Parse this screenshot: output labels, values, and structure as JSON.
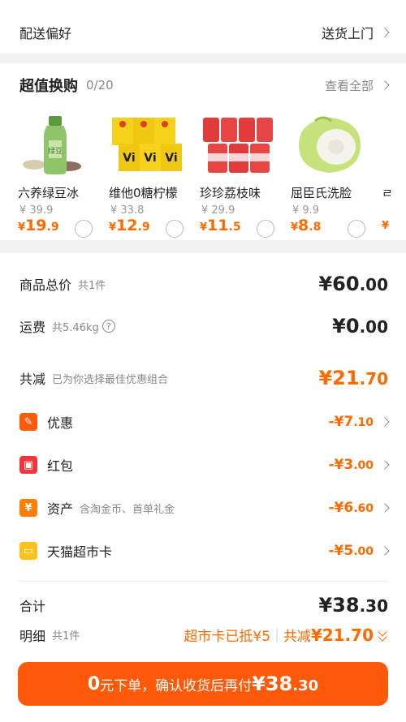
{
  "delivery": {
    "label": "配送偏好",
    "value": "送货上门"
  },
  "deals": {
    "title": "超值换购",
    "count": "0/20",
    "view_all": "查看全部",
    "items": [
      {
        "name": "六养绿豆冰",
        "old_price": "¥ 39.9",
        "price_yen": "¥",
        "price_int": "19",
        "price_frac": ".9",
        "image": "green-bean-drink-bottle"
      },
      {
        "name": "维他0糖柠檬",
        "old_price": "¥ 33.8",
        "price_yen": "¥",
        "price_int": "12",
        "price_frac": ".9",
        "image": "vita-lemon-tea-packs"
      },
      {
        "name": "珍珍荔枝味",
        "old_price": "¥ 29.9",
        "price_yen": "¥",
        "price_int": "11",
        "price_frac": ".5",
        "image": "lychee-soda-cans"
      },
      {
        "name": "屈臣氏洗脸",
        "old_price": "¥ 9.9",
        "price_yen": "¥",
        "price_int": "8",
        "price_frac": ".8",
        "image": "face-towel-roll"
      },
      {
        "name": "ㄹ",
        "old_price": "",
        "price_yen": "¥",
        "price_int": "",
        "price_frac": "",
        "image": "partial-item"
      }
    ]
  },
  "summary": {
    "subtotal": {
      "label": "商品总价",
      "sub": "共1件",
      "yen": "¥",
      "int": "60",
      "frac": ".00"
    },
    "shipping": {
      "label": "运费",
      "sub": "共5.46kg",
      "help": "?",
      "yen": "¥",
      "int": "0",
      "frac": ".00"
    },
    "saved": {
      "label": "共减",
      "sub": "已为你选择最佳优惠组合",
      "yen": "¥",
      "int": "21",
      "frac": ".70"
    },
    "coupon": {
      "label": "优惠",
      "icon_glyph": "✎",
      "amount_int": "-¥7",
      "amount_frac": ".10"
    },
    "red_packet": {
      "label": "红包",
      "icon_glyph": "▣",
      "amount_int": "-¥3",
      "amount_frac": ".00"
    },
    "assets": {
      "label": "资产",
      "sub": "含淘金币、首单礼金",
      "icon_glyph": "¥",
      "amount_int": "-¥6",
      "amount_frac": ".60"
    },
    "tmall_card": {
      "label": "天猫超市卡",
      "icon_glyph": "▭",
      "amount_int": "-¥5",
      "amount_frac": ".00"
    },
    "total": {
      "label": "合计",
      "yen": "¥",
      "int": "38",
      "frac": ".30"
    },
    "detail": {
      "label": "明细",
      "sub": "共1件",
      "card_text": "超市卡已抵¥5",
      "saved_label": "共减",
      "saved_amount": "¥21.70"
    }
  },
  "submit": {
    "zero": "0",
    "text": "元下单，确认收货后再付",
    "yen": "¥",
    "int": "38",
    "frac": ".30"
  },
  "colors": {
    "accent": "#ff6a00",
    "button": "#ff5a0a",
    "coupon_icon": "#ff5a0a",
    "red_packet_icon": "#f2363c",
    "assets_icon": "#ff7d00",
    "card_icon": "#ffc21d"
  }
}
